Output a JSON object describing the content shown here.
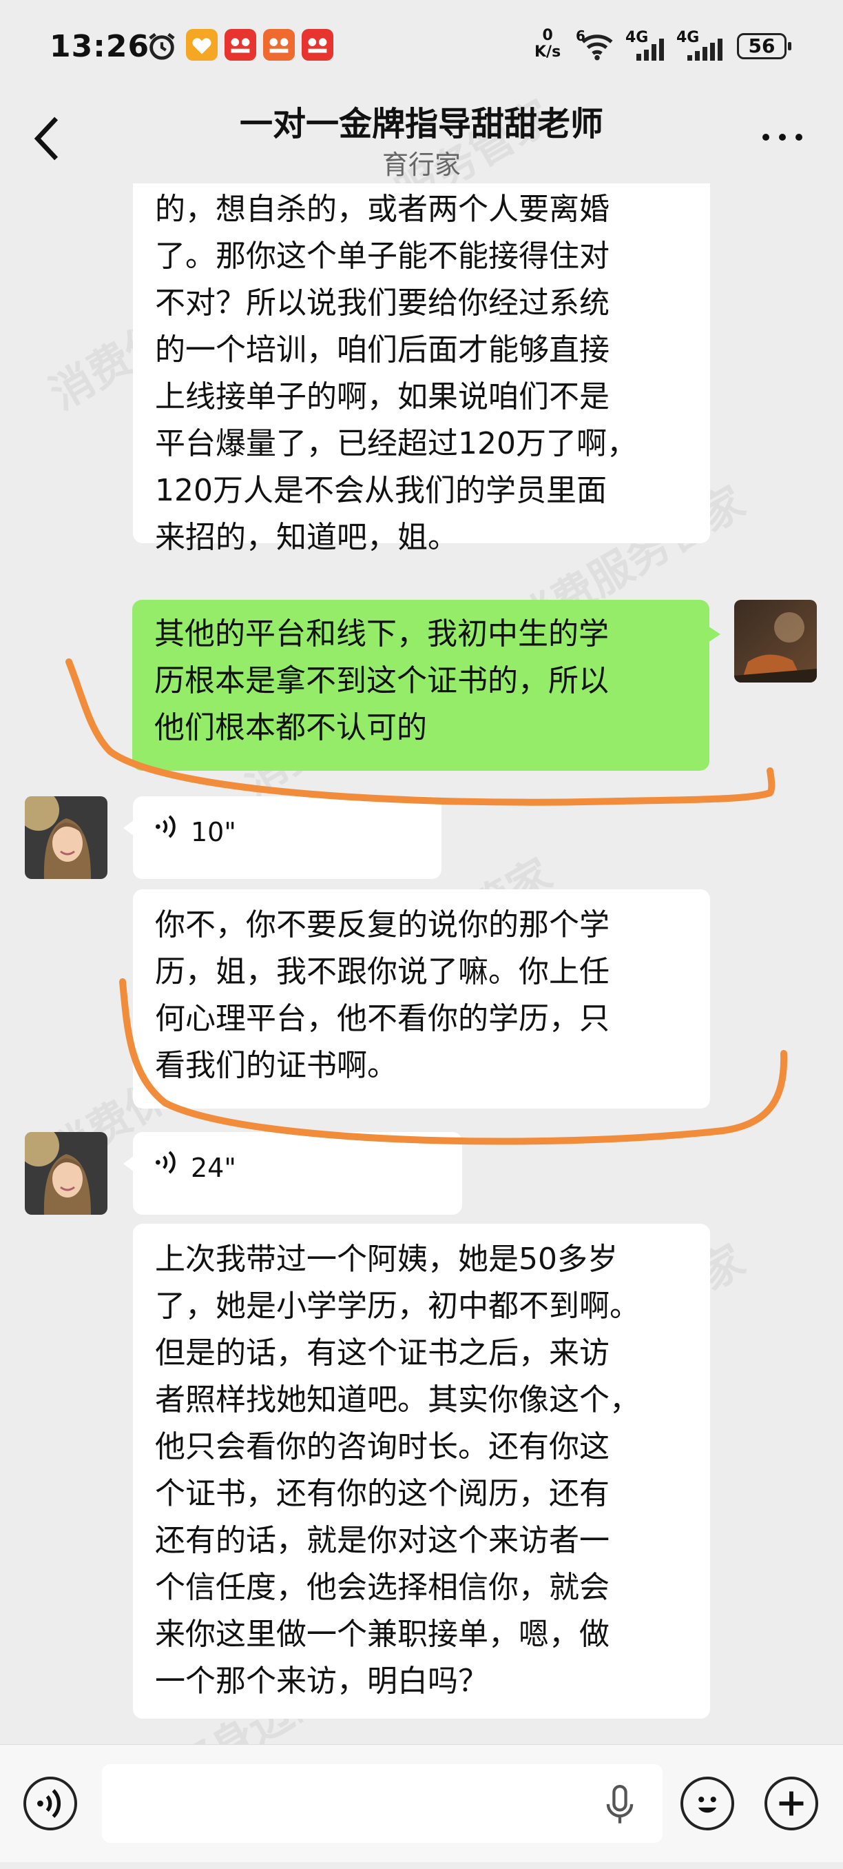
{
  "status_bar": {
    "time": "13:26",
    "net_speed_value": "0",
    "net_speed_unit": "K/s",
    "wifi_badge": "6",
    "signal_1": "4G",
    "signal_2": "4G",
    "battery": "56"
  },
  "header": {
    "title": "一对一金牌指导甜甜老师",
    "subtitle": "育行家"
  },
  "messages": [
    {
      "side": "left",
      "type": "text",
      "lines": [
        "的，想自杀的，或者两个人要离婚",
        "了。那你这个单子能不能接得住对",
        "不对？所以说我们要给你经过系统",
        "的一个培训，咱们后面才能够直接",
        "上线接单子的啊，如果说咱们不是",
        "平台爆量了，已经超过120万了啊，",
        "120万人是不会从我们的学员里面",
        "来招的，知道吧，姐。"
      ]
    },
    {
      "side": "right",
      "type": "text",
      "lines": [
        "其他的平台和线下，我初中生的学",
        "历根本是拿不到这个证书的，所以",
        "他们根本都不认可的"
      ]
    },
    {
      "side": "left",
      "type": "voice",
      "duration": "10\""
    },
    {
      "side": "left",
      "type": "text",
      "lines": [
        "你不，你不要反复的说你的那个学",
        "历，姐，我不跟你说了嘛。你上任",
        "何心理平台，他不看你的学历，只",
        "看我们的证书啊。"
      ]
    },
    {
      "side": "left",
      "type": "voice",
      "duration": "24\""
    },
    {
      "side": "left",
      "type": "text",
      "lines": [
        "上次我带过一个阿姨，她是50多岁",
        "了，她是小学学历，初中都不到啊。",
        "但是的话，有这个证书之后，来访",
        "者照样找她知道吧。其实你像这个，",
        "他只会看你的咨询时长。还有你这",
        "个证书，还有你的这个阅历，还有",
        "还有的话，就是你对这个来访者一",
        "个信任度，他会选择相信你，就会",
        "来你这里做一个兼职接单，嗯，做",
        "一个那个来访，明白吗？"
      ]
    }
  ],
  "watermark": "消费保 您身边的消费服务管家",
  "colors": {
    "background": "#ededed",
    "sent_bubble": "#95ec69",
    "received_bubble": "#ffffff",
    "annotation_stroke": "#f08c3a"
  },
  "icons": {
    "alarm": "alarm-icon",
    "back": "chevron-left-icon",
    "more": "more-dots-icon",
    "voice_mode": "voice-mode-icon",
    "mic": "microphone-icon",
    "emoji": "emoji-icon",
    "plus": "plus-icon"
  }
}
